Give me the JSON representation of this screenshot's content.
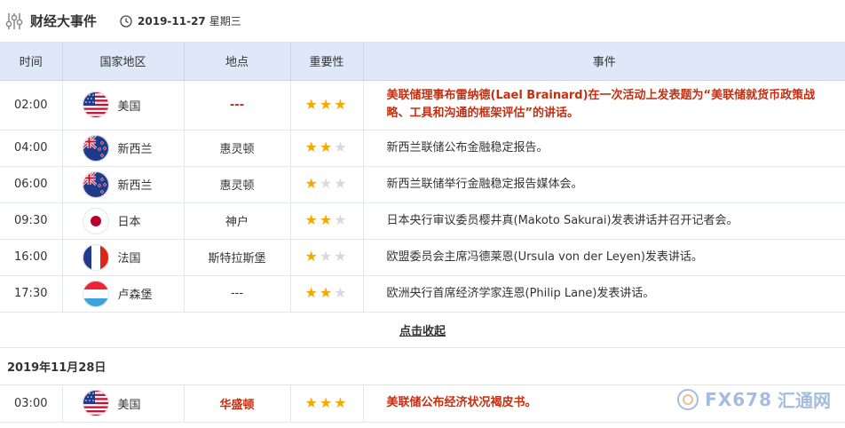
{
  "header": {
    "title": "财经大事件",
    "date": "2019-11-27",
    "weekday": "星期三"
  },
  "columns": [
    "时间",
    "国家地区",
    "地点",
    "重要性",
    "事件"
  ],
  "rows": [
    {
      "time": "02:00",
      "country": "美国",
      "flag": "us",
      "location": "---",
      "location_red": true,
      "stars": 3,
      "event": "美联储理事布雷纳德(Lael Brainard)在一次活动上发表题为“美联储就货币政策战略、工具和沟通的框架评估”的讲话。",
      "event_red": true
    },
    {
      "time": "04:00",
      "country": "新西兰",
      "flag": "nz",
      "location": "惠灵顿",
      "location_red": false,
      "stars": 2,
      "event": "新西兰联储公布金融稳定报告。",
      "event_red": false
    },
    {
      "time": "06:00",
      "country": "新西兰",
      "flag": "nz",
      "location": "惠灵顿",
      "location_red": false,
      "stars": 1,
      "event": "新西兰联储举行金融稳定报告媒体会。",
      "event_red": false
    },
    {
      "time": "09:30",
      "country": "日本",
      "flag": "jp",
      "location": "神户",
      "location_red": false,
      "stars": 2,
      "event": "日本央行审议委员樱井真(Makoto Sakurai)发表讲话并召开记者会。",
      "event_red": false
    },
    {
      "time": "16:00",
      "country": "法国",
      "flag": "fr",
      "location": "斯特拉斯堡",
      "location_red": false,
      "stars": 1,
      "event": "欧盟委员会主席冯德莱恩(Ursula von der Leyen)发表讲话。",
      "event_red": false
    },
    {
      "time": "17:30",
      "country": "卢森堡",
      "flag": "lu",
      "location": "---",
      "location_red": false,
      "stars": 2,
      "event": "欧洲央行首席经济学家连恩(Philip Lane)发表讲话。",
      "event_red": false
    }
  ],
  "collapse_label": "点击收起",
  "next_date": "2019年11月28日",
  "next_rows": [
    {
      "time": "03:00",
      "country": "美国",
      "flag": "us",
      "location": "华盛顿",
      "location_red": true,
      "stars": 3,
      "event": "美联储公布经济状况褐皮书。",
      "event_red": true
    }
  ],
  "watermark": {
    "brand": "FX678",
    "brand2": "汇通网"
  },
  "colors": {
    "accent_red": "#c32f12",
    "header_bg": "#dfe8f8",
    "star_on": "#f5a800",
    "star_off": "#d9d9d9"
  }
}
